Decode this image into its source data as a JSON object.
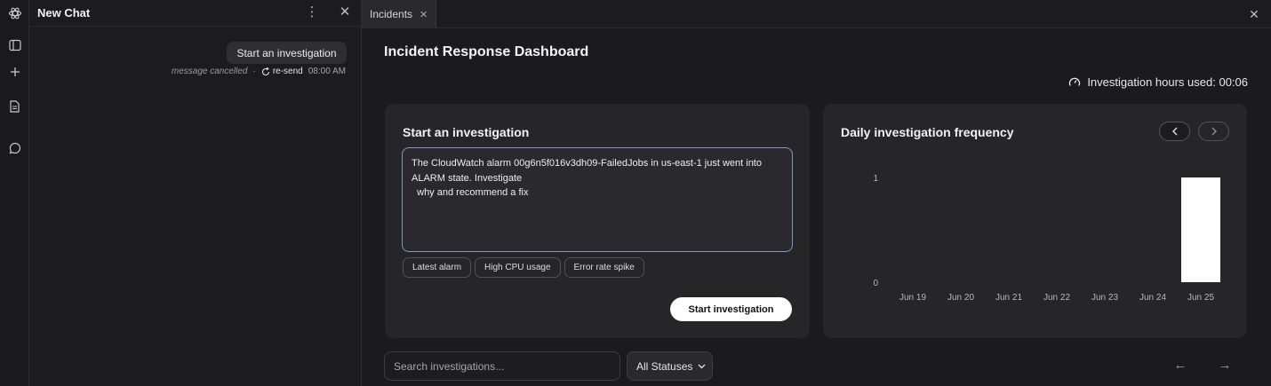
{
  "rail": {
    "icons": [
      "logo-icon",
      "panel-toggle-icon",
      "plus-icon",
      "document-icon",
      "chat-bubble-icon"
    ]
  },
  "chat": {
    "title": "New Chat",
    "message": "Start an investigation",
    "status": "message cancelled",
    "separator": "·",
    "resend_label": "re-send",
    "time": "08:00 AM"
  },
  "tabs": [
    {
      "label": "Incidents",
      "active": true
    }
  ],
  "header": {
    "title": "Incident Response Dashboard",
    "hours_label": "Investigation hours used: 00:06"
  },
  "investigation": {
    "title": "Start an investigation",
    "prompt": "The CloudWatch alarm 00g6n5f016v3dh09-FailedJobs in us-east-1 just went into ALARM state. Investigate\n  why and recommend a fix",
    "chips": [
      "Latest alarm",
      "High CPU usage",
      "Error rate spike"
    ],
    "submit_label": "Start investigation"
  },
  "frequency": {
    "title": "Daily investigation frequency"
  },
  "chart_data": {
    "type": "bar",
    "title": "Daily investigation frequency",
    "categories": [
      "Jun 19",
      "Jun 20",
      "Jun 21",
      "Jun 22",
      "Jun 23",
      "Jun 24",
      "Jun 25"
    ],
    "values": [
      0,
      0,
      0,
      0,
      0,
      0,
      1
    ],
    "yticks": [
      "0",
      "1"
    ],
    "ylim": [
      0,
      1
    ],
    "bar_color": "#ffffff",
    "grid": false
  },
  "filters": {
    "search_placeholder": "Search investigations...",
    "status_value": "All Statuses"
  },
  "colors": {
    "accent_border": "#7f98c6",
    "primary_button": "#ffffff"
  }
}
